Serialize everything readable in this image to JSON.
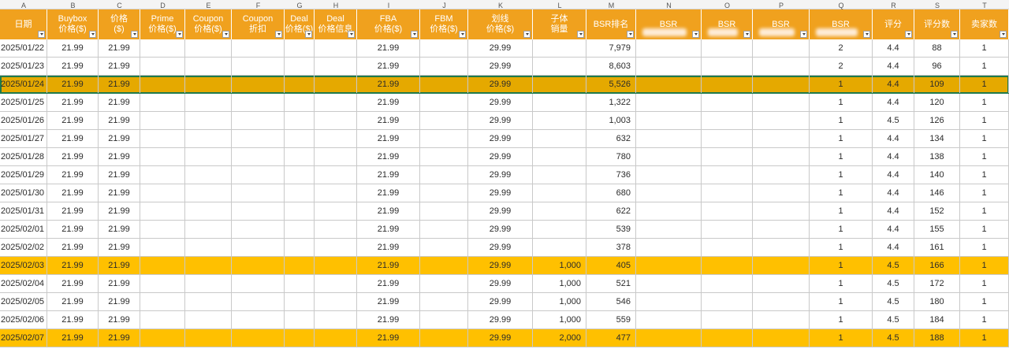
{
  "column_letters": [
    "A",
    "B",
    "C",
    "D",
    "E",
    "F",
    "G",
    "H",
    "I",
    "J",
    "K",
    "L",
    "M",
    "N",
    "O",
    "P",
    "Q",
    "R",
    "S",
    "T"
  ],
  "headers": [
    {
      "lines": [
        "日期"
      ],
      "filter": true
    },
    {
      "lines": [
        "Buybox",
        "价格($)"
      ],
      "filter": true
    },
    {
      "lines": [
        "价格",
        "($)"
      ],
      "filter": true
    },
    {
      "lines": [
        "Prime",
        "价格($)"
      ],
      "filter": true
    },
    {
      "lines": [
        "Coupon",
        "价格($)"
      ],
      "filter": true
    },
    {
      "lines": [
        "Coupon",
        "折扣"
      ],
      "filter": true
    },
    {
      "lines": [
        "Deal",
        "价格($)"
      ],
      "filter": true
    },
    {
      "lines": [
        "Deal",
        "价格信息"
      ],
      "filter": true
    },
    {
      "lines": [
        "FBA",
        "价格($)"
      ],
      "filter": true
    },
    {
      "lines": [
        "FBM",
        "价格($)"
      ],
      "filter": true
    },
    {
      "lines": [
        "划线",
        "价格($)"
      ],
      "filter": true
    },
    {
      "lines": [
        "子体",
        "销量"
      ],
      "filter": true
    },
    {
      "lines": [
        "BSR排名"
      ],
      "filter": true
    },
    {
      "lines": [
        "BSR"
      ],
      "filter": true,
      "redacted": true
    },
    {
      "lines": [
        "BSR"
      ],
      "filter": true,
      "redacted": true
    },
    {
      "lines": [
        "BSR"
      ],
      "filter": true,
      "redacted": true
    },
    {
      "lines": [
        "BSR"
      ],
      "filter": true,
      "redacted": true
    },
    {
      "lines": [
        "评分"
      ],
      "filter": true
    },
    {
      "lines": [
        "评分数"
      ],
      "filter": true
    },
    {
      "lines": [
        "卖家数"
      ],
      "filter": true
    }
  ],
  "rows": [
    {
      "date": "2025/01/22",
      "buybox": "21.99",
      "price": "21.99",
      "fba": "21.99",
      "list": "29.99",
      "sub_sales": "",
      "bsr_rank": "7,979",
      "bsr_q": "2",
      "rating": "4.4",
      "reviews": "88",
      "sellers": "1",
      "style": "white"
    },
    {
      "date": "2025/01/23",
      "buybox": "21.99",
      "price": "21.99",
      "fba": "21.99",
      "list": "29.99",
      "sub_sales": "",
      "bsr_rank": "8,603",
      "bsr_q": "2",
      "rating": "4.4",
      "reviews": "96",
      "sellers": "1",
      "style": "white"
    },
    {
      "date": "2025/01/24",
      "buybox": "21.99",
      "price": "21.99",
      "fba": "21.99",
      "list": "29.99",
      "sub_sales": "",
      "bsr_rank": "5,526",
      "bsr_q": "1",
      "rating": "4.4",
      "reviews": "109",
      "sellers": "1",
      "style": "dark",
      "selected": true
    },
    {
      "date": "2025/01/25",
      "buybox": "21.99",
      "price": "21.99",
      "fba": "21.99",
      "list": "29.99",
      "sub_sales": "",
      "bsr_rank": "1,322",
      "bsr_q": "1",
      "rating": "4.4",
      "reviews": "120",
      "sellers": "1",
      "style": "white"
    },
    {
      "date": "2025/01/26",
      "buybox": "21.99",
      "price": "21.99",
      "fba": "21.99",
      "list": "29.99",
      "sub_sales": "",
      "bsr_rank": "1,003",
      "bsr_q": "1",
      "rating": "4.5",
      "reviews": "126",
      "sellers": "1",
      "style": "white"
    },
    {
      "date": "2025/01/27",
      "buybox": "21.99",
      "price": "21.99",
      "fba": "21.99",
      "list": "29.99",
      "sub_sales": "",
      "bsr_rank": "632",
      "bsr_q": "1",
      "rating": "4.4",
      "reviews": "134",
      "sellers": "1",
      "style": "white"
    },
    {
      "date": "2025/01/28",
      "buybox": "21.99",
      "price": "21.99",
      "fba": "21.99",
      "list": "29.99",
      "sub_sales": "",
      "bsr_rank": "780",
      "bsr_q": "1",
      "rating": "4.4",
      "reviews": "138",
      "sellers": "1",
      "style": "white"
    },
    {
      "date": "2025/01/29",
      "buybox": "21.99",
      "price": "21.99",
      "fba": "21.99",
      "list": "29.99",
      "sub_sales": "",
      "bsr_rank": "736",
      "bsr_q": "1",
      "rating": "4.4",
      "reviews": "140",
      "sellers": "1",
      "style": "white"
    },
    {
      "date": "2025/01/30",
      "buybox": "21.99",
      "price": "21.99",
      "fba": "21.99",
      "list": "29.99",
      "sub_sales": "",
      "bsr_rank": "680",
      "bsr_q": "1",
      "rating": "4.4",
      "reviews": "146",
      "sellers": "1",
      "style": "white"
    },
    {
      "date": "2025/01/31",
      "buybox": "21.99",
      "price": "21.99",
      "fba": "21.99",
      "list": "29.99",
      "sub_sales": "",
      "bsr_rank": "622",
      "bsr_q": "1",
      "rating": "4.4",
      "reviews": "152",
      "sellers": "1",
      "style": "white"
    },
    {
      "date": "2025/02/01",
      "buybox": "21.99",
      "price": "21.99",
      "fba": "21.99",
      "list": "29.99",
      "sub_sales": "",
      "bsr_rank": "539",
      "bsr_q": "1",
      "rating": "4.4",
      "reviews": "155",
      "sellers": "1",
      "style": "white"
    },
    {
      "date": "2025/02/02",
      "buybox": "21.99",
      "price": "21.99",
      "fba": "21.99",
      "list": "29.99",
      "sub_sales": "",
      "bsr_rank": "378",
      "bsr_q": "1",
      "rating": "4.4",
      "reviews": "161",
      "sellers": "1",
      "style": "white"
    },
    {
      "date": "2025/02/03",
      "buybox": "21.99",
      "price": "21.99",
      "fba": "21.99",
      "list": "29.99",
      "sub_sales": "1,000",
      "bsr_rank": "405",
      "bsr_q": "1",
      "rating": "4.5",
      "reviews": "166",
      "sellers": "1",
      "style": "gold"
    },
    {
      "date": "2025/02/04",
      "buybox": "21.99",
      "price": "21.99",
      "fba": "21.99",
      "list": "29.99",
      "sub_sales": "1,000",
      "bsr_rank": "521",
      "bsr_q": "1",
      "rating": "4.5",
      "reviews": "172",
      "sellers": "1",
      "style": "white"
    },
    {
      "date": "2025/02/05",
      "buybox": "21.99",
      "price": "21.99",
      "fba": "21.99",
      "list": "29.99",
      "sub_sales": "1,000",
      "bsr_rank": "546",
      "bsr_q": "1",
      "rating": "4.5",
      "reviews": "180",
      "sellers": "1",
      "style": "white"
    },
    {
      "date": "2025/02/06",
      "buybox": "21.99",
      "price": "21.99",
      "fba": "21.99",
      "list": "29.99",
      "sub_sales": "1,000",
      "bsr_rank": "559",
      "bsr_q": "1",
      "rating": "4.5",
      "reviews": "184",
      "sellers": "1",
      "style": "white"
    },
    {
      "date": "2025/02/07",
      "buybox": "21.99",
      "price": "21.99",
      "fba": "21.99",
      "list": "29.99",
      "sub_sales": "2,000",
      "bsr_rank": "477",
      "bsr_q": "1",
      "rating": "4.5",
      "reviews": "188",
      "sellers": "1",
      "style": "gold"
    }
  ]
}
